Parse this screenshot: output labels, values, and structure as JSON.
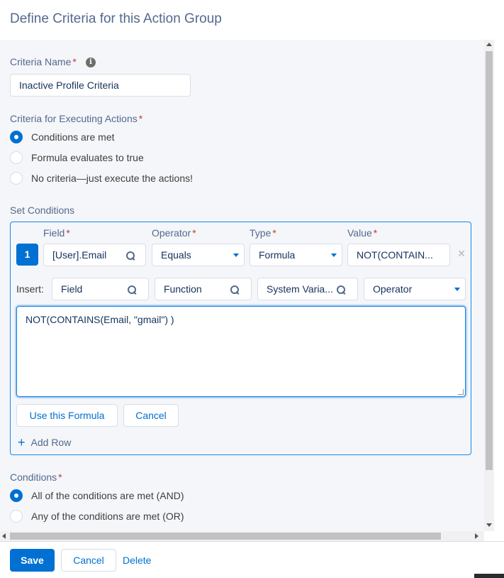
{
  "dialog": {
    "title": "Define Criteria for this Action Group"
  },
  "criteria_name": {
    "label": "Criteria Name",
    "required_mark": "*",
    "info_icon": "info-icon",
    "value": "Inactive Profile Criteria"
  },
  "executing": {
    "label": "Criteria for Executing Actions",
    "required_mark": "*",
    "options": [
      {
        "label": "Conditions are met",
        "checked": true
      },
      {
        "label": "Formula evaluates to true",
        "checked": false
      },
      {
        "label": "No criteria—just execute the actions!",
        "checked": false
      }
    ]
  },
  "set_conditions": {
    "label": "Set Conditions",
    "headers": {
      "field": "Field",
      "operator": "Operator",
      "type": "Type",
      "value": "Value",
      "required_mark": "*"
    },
    "row": {
      "number": "1",
      "field": "[User].Email",
      "operator": "Equals",
      "type": "Formula",
      "value": "NOT(CONTAIN..."
    },
    "insert": {
      "label": "Insert:",
      "field": "Field",
      "function": "Function",
      "system_variable": "System Varia...",
      "operator": "Operator"
    },
    "formula": "NOT(CONTAINS(Email, \"gmail\") )",
    "use_formula_button": "Use this Formula",
    "cancel_button": "Cancel",
    "add_row": "Add Row"
  },
  "conditions": {
    "label": "Conditions",
    "required_mark": "*",
    "options": [
      {
        "label": "All of the conditions are met (AND)",
        "checked": true
      },
      {
        "label": "Any of the conditions are met (OR)",
        "checked": false
      }
    ]
  },
  "footer": {
    "save": "Save",
    "cancel": "Cancel",
    "delete": "Delete"
  },
  "colors": {
    "brand": "#0070d2",
    "required": "#c23934",
    "label": "#54698d"
  }
}
